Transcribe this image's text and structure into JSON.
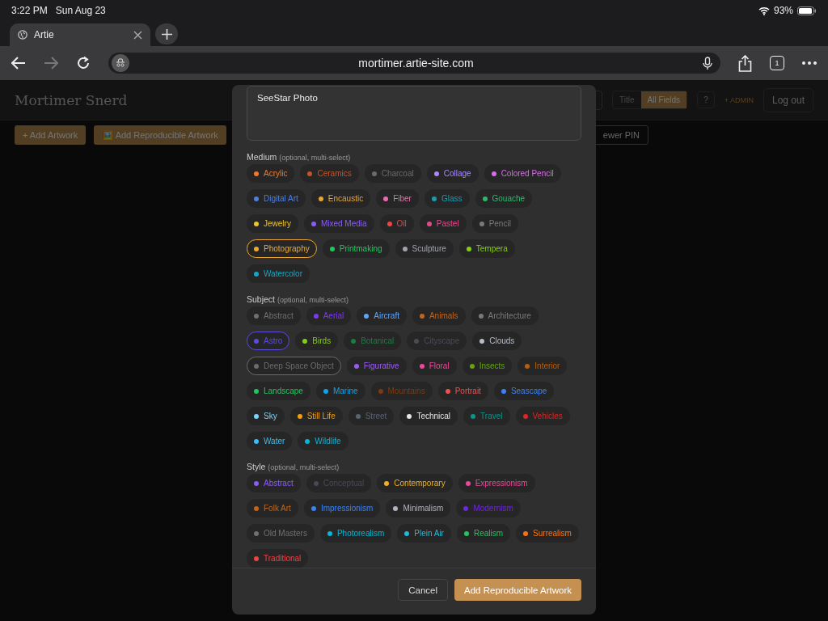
{
  "status_bar": {
    "time": "3:22 PM",
    "date": "Sun Aug 23",
    "battery": "93%"
  },
  "browser": {
    "tab_title": "Artie",
    "url": "mortimer.artie-site.com",
    "tab_count": "1"
  },
  "page": {
    "site_title": "Mortimer Snerd",
    "search_toggle": [
      {
        "label": "Title",
        "selected": false
      },
      {
        "label": "All Fields",
        "selected": true
      }
    ],
    "help": "?",
    "admin": "+ ADMIN",
    "logout": "Log out",
    "actions": [
      {
        "label": "+ Add Artwork",
        "kind": "primary"
      },
      {
        "label": "🖼️ Add Reproducible Artwork",
        "kind": "primary"
      },
      {
        "label": "ewer PIN",
        "kind": "outline"
      }
    ]
  },
  "modal": {
    "title_value": "SeeStar Photo",
    "sections": [
      {
        "label": "Medium",
        "hint": "(optional, multi-select)",
        "chips": [
          {
            "label": "Acrylic",
            "color": "#f07a2a",
            "selected": false
          },
          {
            "label": "Ceramics",
            "color": "#c2542a",
            "selected": false
          },
          {
            "label": "Charcoal",
            "color": "#6b6b6b",
            "selected": false
          },
          {
            "label": "Collage",
            "color": "#a78bfa",
            "selected": false
          },
          {
            "label": "Colored Pencil",
            "color": "#d56ee8",
            "selected": false
          },
          {
            "label": "Digital Art",
            "color": "#4f7fe0",
            "selected": false
          },
          {
            "label": "Encaustic",
            "color": "#e8a530",
            "selected": false
          },
          {
            "label": "Fiber",
            "color": "#ec6ab0",
            "selected": false
          },
          {
            "label": "Glass",
            "color": "#1a9bb0",
            "selected": false
          },
          {
            "label": "Gouache",
            "color": "#2fb86a",
            "selected": false
          },
          {
            "label": "Jewelry",
            "color": "#eac530",
            "selected": false
          },
          {
            "label": "Mixed Media",
            "color": "#8b5cf6",
            "selected": false
          },
          {
            "label": "Oil",
            "color": "#ef4444",
            "selected": false
          },
          {
            "label": "Pastel",
            "color": "#e04d8e",
            "selected": false
          },
          {
            "label": "Pencil",
            "color": "#7a7a7a",
            "selected": false
          },
          {
            "label": "Photography",
            "color": "#f0a830",
            "selected": true
          },
          {
            "label": "Printmaking",
            "color": "#22c55e",
            "selected": false
          },
          {
            "label": "Sculpture",
            "color": "#a0a4b0",
            "selected": false
          },
          {
            "label": "Tempera",
            "color": "#84cc16",
            "selected": false
          },
          {
            "label": "Watercolor",
            "color": "#16a8c8",
            "selected": false
          }
        ]
      },
      {
        "label": "Subject",
        "hint": "(optional, multi-select)",
        "chips": [
          {
            "label": "Abstract",
            "color": "#6f6f72",
            "selected": false
          },
          {
            "label": "Aerial",
            "color": "#7c3aed",
            "selected": false
          },
          {
            "label": "Aircraft",
            "color": "#60a5fa",
            "selected": false
          },
          {
            "label": "Animals",
            "color": "#c2651a",
            "selected": false
          },
          {
            "label": "Architecture",
            "color": "#7a7a7a",
            "selected": false
          },
          {
            "label": "Astro",
            "color": "#5b4be0",
            "selected": true
          },
          {
            "label": "Birds",
            "color": "#84cc16",
            "selected": false
          },
          {
            "label": "Botanical",
            "color": "#15803d",
            "selected": false
          },
          {
            "label": "Cityscape",
            "color": "#4b4b55",
            "selected": false
          },
          {
            "label": "Clouds",
            "color": "#b8bcc8",
            "selected": false
          },
          {
            "label": "Deep Space Object",
            "color": "#6b6b6b",
            "selected": true
          },
          {
            "label": "Figurative",
            "color": "#9a5cf0",
            "selected": false
          },
          {
            "label": "Floral",
            "color": "#ec4899",
            "selected": false
          },
          {
            "label": "Insects",
            "color": "#65a30d",
            "selected": false
          },
          {
            "label": "Interior",
            "color": "#b45f10",
            "selected": false
          },
          {
            "label": "Landscape",
            "color": "#22c55e",
            "selected": false
          },
          {
            "label": "Marine",
            "color": "#0ea5e9",
            "selected": false
          },
          {
            "label": "Mountains",
            "color": "#7c3a12",
            "selected": false
          },
          {
            "label": "Portrait",
            "color": "#f05050",
            "selected": false
          },
          {
            "label": "Seascape",
            "color": "#3b82f6",
            "selected": false
          },
          {
            "label": "Sky",
            "color": "#7dd3fc",
            "selected": false
          },
          {
            "label": "Still Life",
            "color": "#f59e0b",
            "selected": false
          },
          {
            "label": "Street",
            "color": "#5a6370",
            "selected": false
          },
          {
            "label": "Technical",
            "color": "#e5e7eb",
            "selected": false
          },
          {
            "label": "Travel",
            "color": "#0d9488",
            "selected": false
          },
          {
            "label": "Vehicles",
            "color": "#dc2626",
            "selected": false
          },
          {
            "label": "Water",
            "color": "#38bdf8",
            "selected": false
          },
          {
            "label": "Wildlife",
            "color": "#06b6d4",
            "selected": false
          }
        ]
      },
      {
        "label": "Style",
        "hint": "(optional, multi-select)",
        "chips": [
          {
            "label": "Abstract",
            "color": "#8b5cf6",
            "selected": false
          },
          {
            "label": "Conceptual",
            "color": "#474a55",
            "selected": false
          },
          {
            "label": "Contemporary",
            "color": "#f0b020",
            "selected": false
          },
          {
            "label": "Expressionism",
            "color": "#ec4899",
            "selected": false
          },
          {
            "label": "Folk Art",
            "color": "#c2651a",
            "selected": false
          },
          {
            "label": "Impressionism",
            "color": "#3b82f6",
            "selected": false
          },
          {
            "label": "Minimalism",
            "color": "#b0b4c0",
            "selected": false
          },
          {
            "label": "Modernism",
            "color": "#6d28d9",
            "selected": false
          },
          {
            "label": "Old Masters",
            "color": "#707070",
            "selected": false
          },
          {
            "label": "Photorealism",
            "color": "#06b6d4",
            "selected": false
          },
          {
            "label": "Plein Air",
            "color": "#22b8d8",
            "selected": false
          },
          {
            "label": "Realism",
            "color": "#22c55e",
            "selected": false
          },
          {
            "label": "Surrealism",
            "color": "#f97316",
            "selected": false
          },
          {
            "label": "Traditional",
            "color": "#ef4444",
            "selected": false
          }
        ]
      }
    ],
    "buttons": [
      {
        "label": "Cancel",
        "kind": "secondary"
      },
      {
        "label": "Add Reproducible Artwork",
        "kind": "primary"
      }
    ]
  }
}
